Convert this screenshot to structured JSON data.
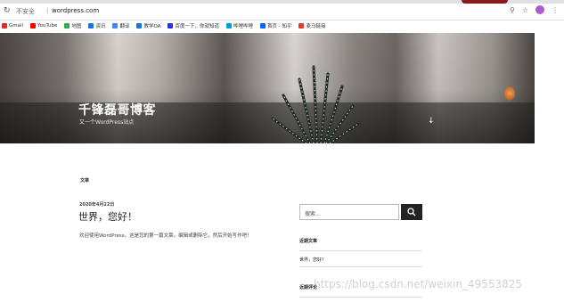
{
  "browser": {
    "security_label": "不安全",
    "url": "wordpress.com",
    "bookmarks": [
      {
        "label": "Gmail",
        "color": "#d93025"
      },
      {
        "label": "YouTube",
        "color": "#ff0000"
      },
      {
        "label": "地图",
        "color": "#34a853"
      },
      {
        "label": "资讯",
        "color": "#1a73e8"
      },
      {
        "label": "翻译",
        "color": "#4285f4"
      },
      {
        "label": "教学OA",
        "color": "#1a73e8"
      },
      {
        "label": "百度一下，你就知道",
        "color": "#2932e1"
      },
      {
        "label": "哔哩哔哩",
        "color": "#00a1d6"
      },
      {
        "label": "首页 - 知乎",
        "color": "#0066ff"
      },
      {
        "label": "麦马链接",
        "color": "#e53935"
      }
    ]
  },
  "hero": {
    "site_title": "千锋磊哥博客",
    "tagline": "又一个WordPress站点",
    "scroll_icon": "↓"
  },
  "main": {
    "section_heading": "文章",
    "post": {
      "date": "2020年4月22日",
      "title": "世界，您好！",
      "excerpt": "欢迎使用WordPress。这是您的第一篇文章。编辑或删除它，然后开始写作吧！"
    }
  },
  "sidebar": {
    "search_placeholder": "搜索...",
    "recent_posts_title": "近期文章",
    "recent_post_link": "世界，您好！",
    "recent_comments_title": "近期评论"
  },
  "watermark": "https://blog.csdn.net/weixin_49553825"
}
